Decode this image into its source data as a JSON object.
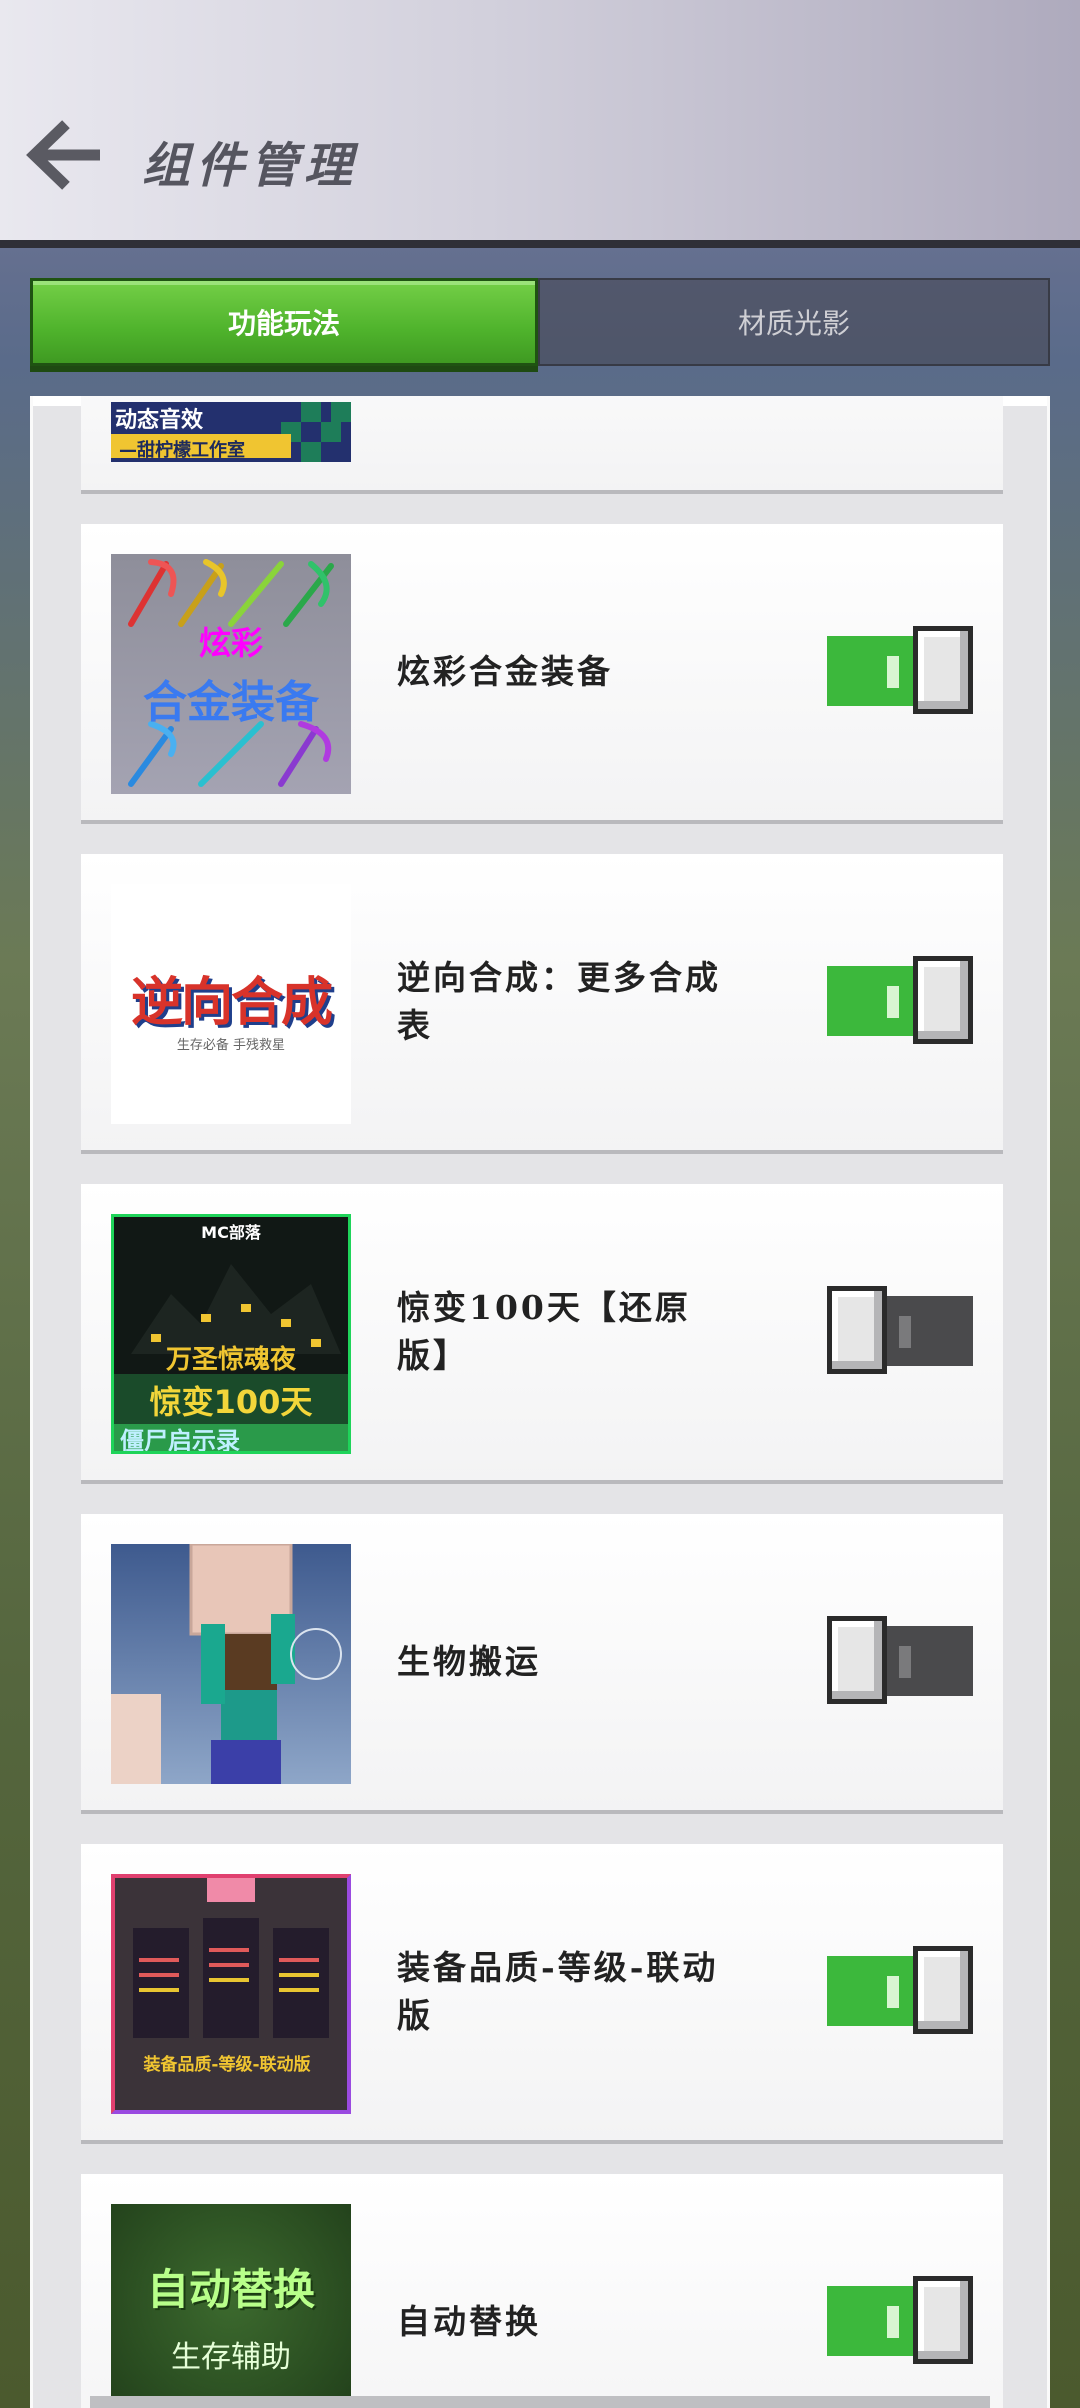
{
  "header": {
    "title": "组件管理"
  },
  "tabs": [
    {
      "label": "功能玩法",
      "active": true
    },
    {
      "label": "材质光影",
      "active": false
    }
  ],
  "partial_item": {
    "thumb_text_top": "动态音效",
    "thumb_text_bottom": "—甜柠檬工作室"
  },
  "items": [
    {
      "label": "炫彩合金装备",
      "enabled": true,
      "thumb": {
        "line1": "炫彩",
        "line2": "合金装备"
      }
    },
    {
      "label": "逆向合成：更多合成表",
      "enabled": true,
      "thumb": {
        "line1": "逆向合成",
        "line2": "生存必备  手残救星"
      }
    },
    {
      "label": "惊变100天【还原版】",
      "enabled": false,
      "thumb": {
        "line1": "MC部落",
        "line2": "万圣惊魂夜",
        "line3": "惊变100天",
        "line4": "僵尸启示录"
      }
    },
    {
      "label": "生物搬运",
      "enabled": false,
      "thumb": {}
    },
    {
      "label": "装备品质-等级-联动版",
      "enabled": true,
      "thumb": {
        "line1": "装备品质-等级-联动版"
      }
    },
    {
      "label": "自动替换",
      "enabled": true,
      "thumb": {
        "line1": "自动替换",
        "line2": "生存辅助"
      }
    }
  ],
  "colors": {
    "toggle_on": "#3cb83c",
    "toggle_off": "#4a4a4c",
    "tab_active": "#5cbf35"
  }
}
